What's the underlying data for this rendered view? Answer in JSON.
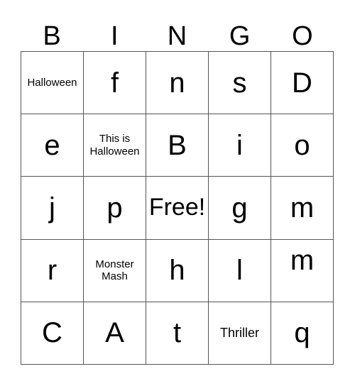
{
  "card": {
    "header": {
      "letters": [
        "B",
        "I",
        "N",
        "G",
        "O"
      ]
    },
    "grid": {
      "columns": 5,
      "rows": 5,
      "cells": [
        {
          "text": "Halloween",
          "kind": "word",
          "size": "word"
        },
        {
          "text": "f",
          "kind": "letter",
          "size": "letter"
        },
        {
          "text": "n",
          "kind": "letter",
          "size": "letter"
        },
        {
          "text": "s",
          "kind": "letter",
          "size": "letter"
        },
        {
          "text": "D",
          "kind": "letter",
          "size": "letter"
        },
        {
          "text": "e",
          "kind": "letter",
          "size": "letter"
        },
        {
          "text": "This is Halloween",
          "kind": "word",
          "size": "word-2"
        },
        {
          "text": "B",
          "kind": "letter",
          "size": "letter"
        },
        {
          "text": "i",
          "kind": "letter",
          "size": "letter"
        },
        {
          "text": "o",
          "kind": "letter",
          "size": "letter"
        },
        {
          "text": "j",
          "kind": "letter",
          "size": "letter"
        },
        {
          "text": "p",
          "kind": "letter",
          "size": "letter"
        },
        {
          "text": "Free!",
          "kind": "free",
          "size": "free"
        },
        {
          "text": "g",
          "kind": "letter",
          "size": "letter"
        },
        {
          "text": "m",
          "kind": "letter",
          "size": "letter"
        },
        {
          "text": "r",
          "kind": "letter",
          "size": "letter"
        },
        {
          "text": "Monster Mash",
          "kind": "word",
          "size": "word-2"
        },
        {
          "text": "h",
          "kind": "letter",
          "size": "letter"
        },
        {
          "text": "l",
          "kind": "letter",
          "size": "letter"
        },
        {
          "text": "m",
          "kind": "letter",
          "size": "letter",
          "align": "top"
        },
        {
          "text": "C",
          "kind": "letter",
          "size": "letter"
        },
        {
          "text": "A",
          "kind": "letter",
          "size": "letter"
        },
        {
          "text": "t",
          "kind": "letter",
          "size": "letter"
        },
        {
          "text": "Thriller",
          "kind": "word",
          "size": "word-lg"
        },
        {
          "text": "q",
          "kind": "letter",
          "size": "letter"
        }
      ]
    },
    "colors": {
      "text": "#000000",
      "background": "#ffffff",
      "gridline": "#555555"
    }
  }
}
